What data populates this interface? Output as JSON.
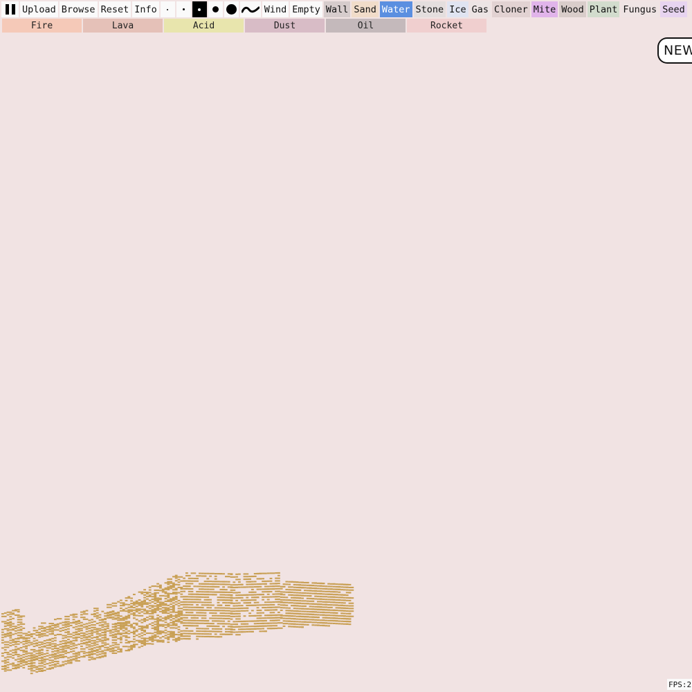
{
  "toolbar": {
    "upload_label": "Upload",
    "browse_label": "Browse",
    "reset_label": "Reset",
    "info_label": "Info",
    "selected_brush_size_index": 2,
    "pause_icon": "pause-icon",
    "wind_icon": "wind-wave-icon",
    "elements": [
      {
        "label": "Wind",
        "color": "#fafafa"
      },
      {
        "label": "Empty",
        "color": "#fafafa"
      },
      {
        "label": "Wall",
        "color": "#d6cccc"
      },
      {
        "label": "Sand",
        "color": "#f1dcc9"
      },
      {
        "label": "Water",
        "color": "#5b8fe0",
        "selected": true
      },
      {
        "label": "Stone",
        "color": "#e4dede"
      },
      {
        "label": "Ice",
        "color": "#e0e4f1"
      },
      {
        "label": "Gas",
        "color": "#ece4e4"
      },
      {
        "label": "Cloner",
        "color": "#e2d2d2"
      },
      {
        "label": "Mite",
        "color": "#e1b4ea"
      },
      {
        "label": "Wood",
        "color": "#d9cdca"
      },
      {
        "label": "Plant",
        "color": "#d2dccd"
      },
      {
        "label": "Fungus",
        "color": "#efe4e4"
      },
      {
        "label": "Seed",
        "color": "#e7d4f0"
      }
    ]
  },
  "second_row": [
    {
      "label": "Fire",
      "color": "#f5c9b8"
    },
    {
      "label": "Lava",
      "color": "#e5c1b8"
    },
    {
      "label": "Acid",
      "color": "#e8e5ad"
    },
    {
      "label": "Dust",
      "color": "#d8bcc6"
    },
    {
      "label": "Oil",
      "color": "#c4b9bb"
    },
    {
      "label": "Rocket",
      "color": "#f0cfcf"
    }
  ],
  "canvas": {
    "background": "#f1e3e3",
    "sand_color": "#c9a055"
  },
  "new_badge": "NEW",
  "fps_label": "FPS:2"
}
